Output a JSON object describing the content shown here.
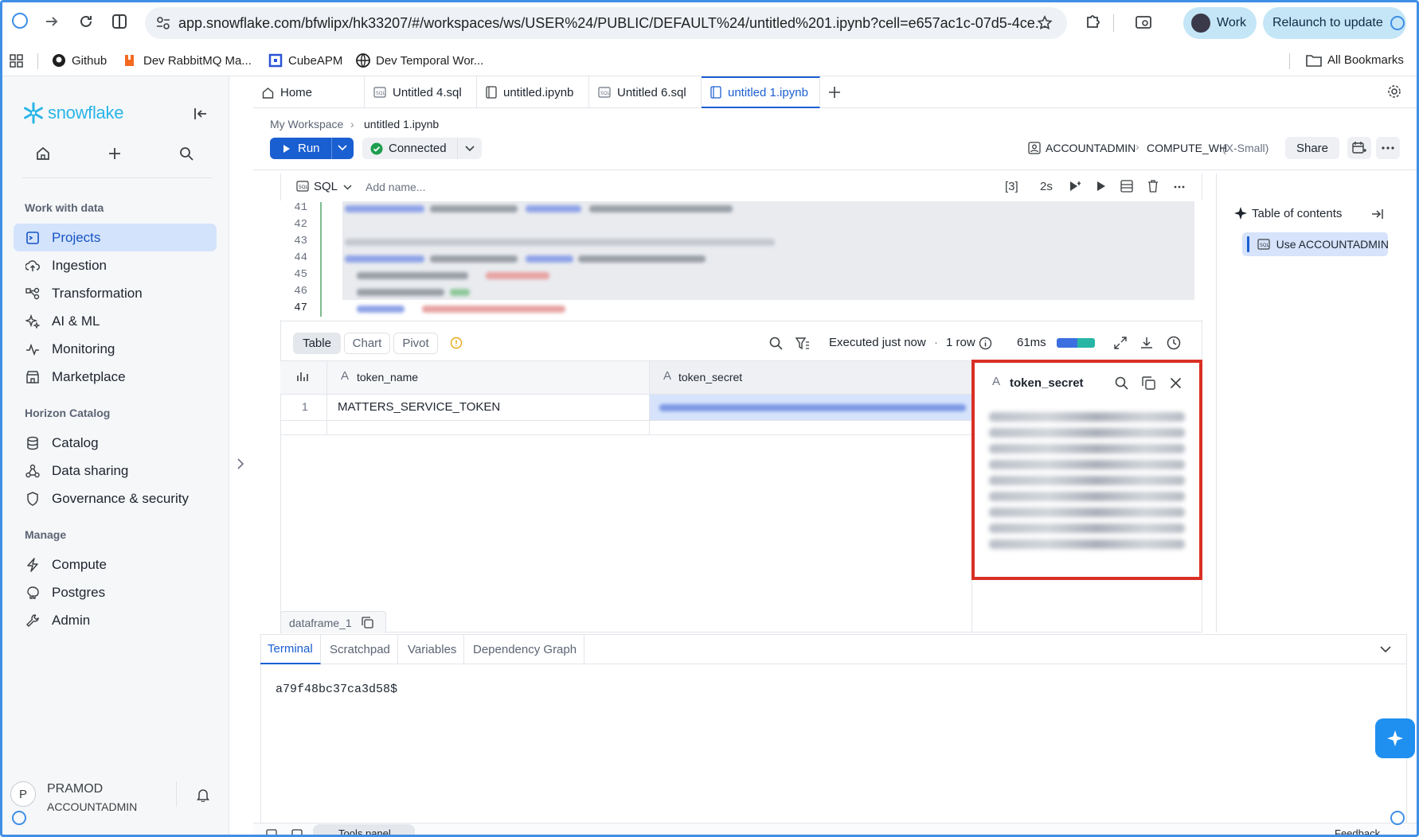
{
  "browser": {
    "url": "app.snowflake.com/bfwlipx/hk33207/#/workspaces/ws/USER%24/PUBLIC/DEFAULT%24/untitled%201.ipynb?cell=e657ac1c-07d5-4ce...",
    "profile_label": "Work",
    "relaunch_label": "Relaunch to update",
    "bookmarks": [
      "Github",
      "Dev RabbitMQ Ma...",
      "CubeAPM",
      "Dev Temporal Wor..."
    ],
    "all_bookmarks_label": "All Bookmarks"
  },
  "sidebar": {
    "logo_text": "snowflake",
    "sections": [
      {
        "heading": "Work with data",
        "items": [
          "Projects",
          "Ingestion",
          "Transformation",
          "AI & ML",
          "Monitoring",
          "Marketplace"
        ]
      },
      {
        "heading": "Horizon Catalog",
        "items": [
          "Catalog",
          "Data sharing",
          "Governance & security"
        ]
      },
      {
        "heading": "Manage",
        "items": [
          "Compute",
          "Postgres",
          "Admin"
        ]
      }
    ],
    "user": {
      "initial": "P",
      "name": "PRAMOD",
      "role": "ACCOUNTADMIN"
    }
  },
  "tabs": [
    "Home",
    "Untitled 4.sql",
    "untitled.ipynb",
    "Untitled 6.sql",
    "untitled 1.ipynb"
  ],
  "breadcrumb": {
    "root": "My Workspace",
    "current": "untitled 1.ipynb"
  },
  "toolbar": {
    "run_label": "Run",
    "connected_label": "Connected",
    "role": "ACCOUNTADMIN",
    "warehouse": "COMPUTE_WH",
    "warehouse_size": "(X-Small)",
    "share_label": "Share"
  },
  "cell": {
    "language": "SQL",
    "name_placeholder": "Add name...",
    "exec_count": "[3]",
    "duration": "2s",
    "line_numbers": [
      "41",
      "42",
      "43",
      "44",
      "45",
      "46",
      "47"
    ]
  },
  "results": {
    "view_tabs": [
      "Table",
      "Chart",
      "Pivot"
    ],
    "status": "Executed just now",
    "rows_label": "1 row",
    "timing": "61ms",
    "columns": [
      "token_name",
      "token_secret"
    ],
    "rows": [
      {
        "index": "1",
        "token_name": "MATTERS_SERVICE_TOKEN"
      }
    ],
    "dataframe_label": "dataframe_1"
  },
  "popover": {
    "title": "token_secret"
  },
  "toc": {
    "title": "Table of contents",
    "items": [
      "Use ACCOUNTADMIN r..."
    ]
  },
  "bottom_panel": {
    "tabs": [
      "Terminal",
      "Scratchpad",
      "Variables",
      "Dependency Graph"
    ],
    "terminal_output": "a79f48bc37ca3d58$"
  },
  "footer": {
    "tools_panel": "Tools panel",
    "feedback": "Feedback"
  },
  "colors": {
    "accent": "#1a5fd1",
    "highlight_box": "#d93025",
    "brand": "#29b5e8"
  }
}
